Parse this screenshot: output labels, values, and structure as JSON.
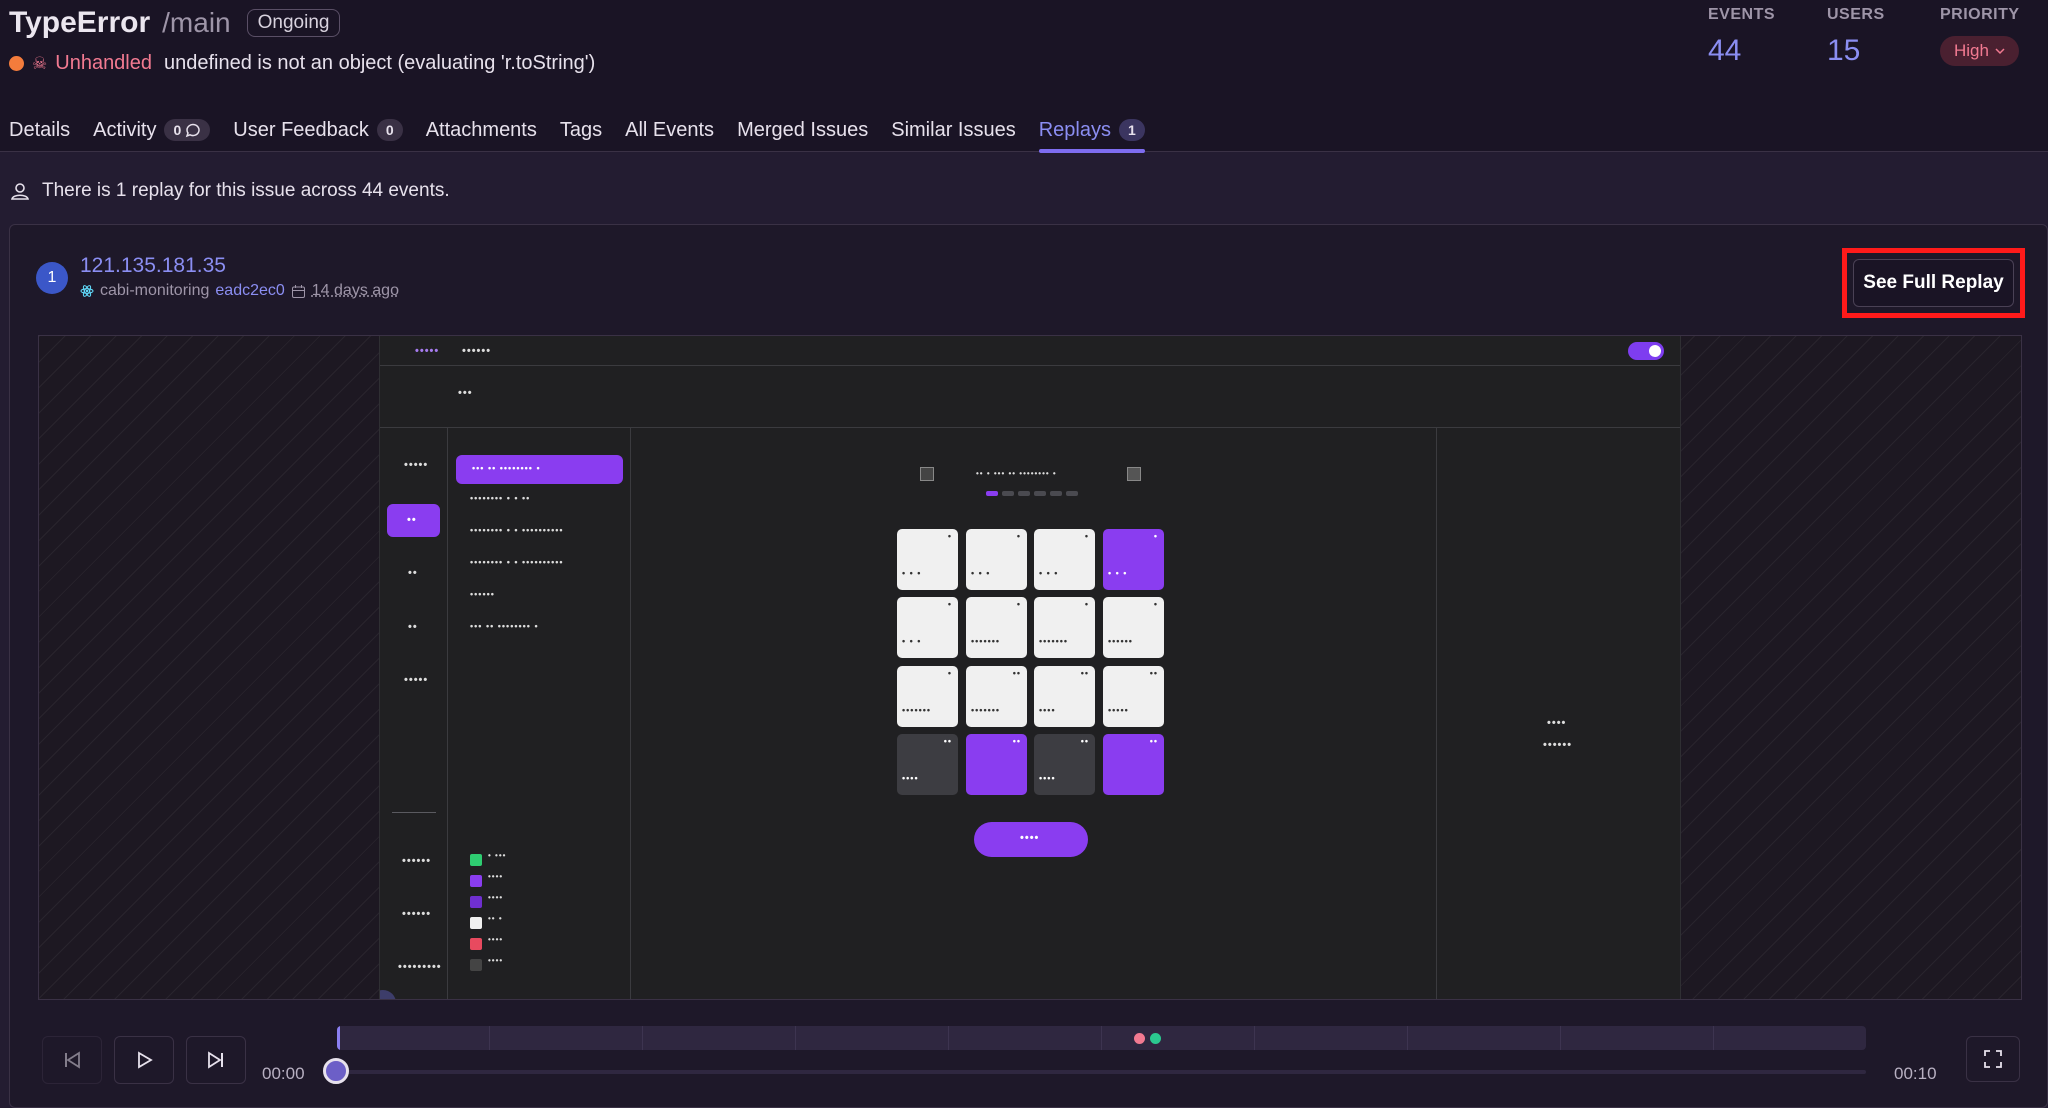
{
  "issue": {
    "type": "TypeError",
    "path": "/main",
    "status": "Ongoing",
    "level_label": "Unhandled",
    "message": "undefined is not an object (evaluating 'r.toString')"
  },
  "stats": {
    "events_label": "EVENTS",
    "events_value": "44",
    "users_label": "USERS",
    "users_value": "15",
    "priority_label": "PRIORITY",
    "priority_value": "High"
  },
  "tabs": [
    {
      "label": "Details"
    },
    {
      "label": "Activity",
      "badge": "0"
    },
    {
      "label": "User Feedback",
      "badge": "0"
    },
    {
      "label": "Attachments"
    },
    {
      "label": "Tags"
    },
    {
      "label": "All Events"
    },
    {
      "label": "Merged Issues"
    },
    {
      "label": "Similar Issues"
    },
    {
      "label": "Replays",
      "badge": "1",
      "active": true
    }
  ],
  "replay_info": "There is 1 replay for this issue across 44 events.",
  "replay": {
    "index": "1",
    "user": "121.135.181.35",
    "project": "cabi-monitoring",
    "commit": "eadc2ec0",
    "time_ago": "14 days ago",
    "see_full_label": "See Full Replay"
  },
  "player": {
    "current_time": "00:00",
    "total_time": "00:10",
    "progress": 0
  },
  "colors": {
    "accent": "#8b8ef2",
    "unhandled": "#f27a91",
    "error_dot": "#f47c3c",
    "highlight_box": "#ff1a1a",
    "replay_purple": "#8a3df0"
  },
  "icons": {
    "status_dot": "orange-dot-icon",
    "unhandled": "skull-icon",
    "activity": "comment-icon",
    "info": "user-icon",
    "project": "react-icon",
    "date": "calendar-icon",
    "rewind": "skip-back-icon",
    "play": "play-icon",
    "next": "skip-next-icon",
    "fullscreen": "fullscreen-icon"
  }
}
